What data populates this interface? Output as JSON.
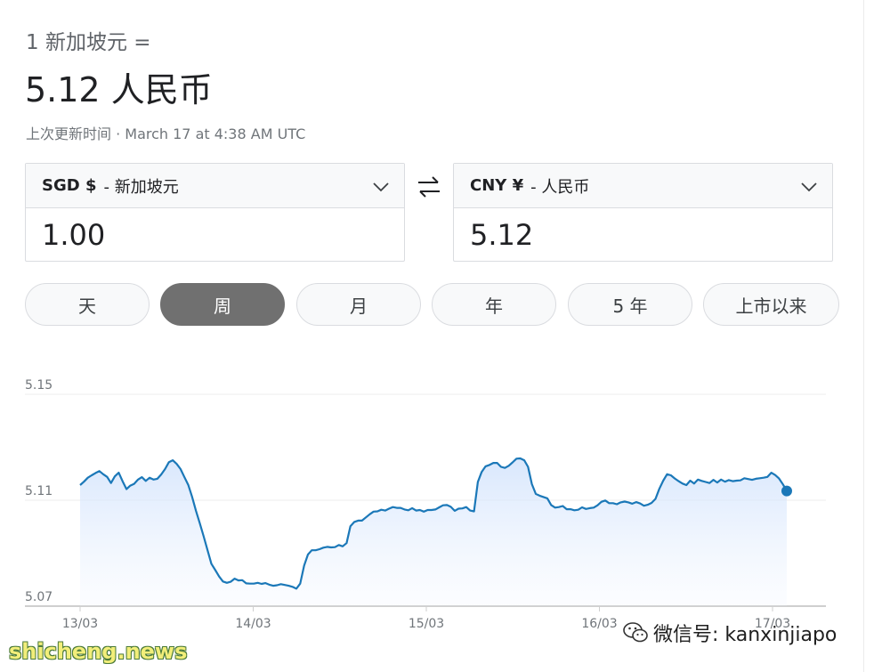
{
  "header": {
    "subtitle": "1 新加坡元 =",
    "rate": "5.12 人民币",
    "updated": "上次更新时间 · March 17 at 4:38 AM UTC"
  },
  "from": {
    "code": "SGD $",
    "name": "- 新加坡元",
    "amount": "1.00"
  },
  "to": {
    "code": "CNY ¥",
    "name": "- 人民币",
    "amount": "5.12"
  },
  "swap_icon": "swap-arrows-icon",
  "ranges": [
    {
      "label": "天",
      "active": false
    },
    {
      "label": "周",
      "active": true
    },
    {
      "label": "月",
      "active": false
    },
    {
      "label": "年",
      "active": false
    },
    {
      "label": "5 年",
      "active": false
    },
    {
      "label": "上市以来",
      "active": false
    }
  ],
  "colors": {
    "line": "#1a73e8",
    "accent": "#1b78b8",
    "active_pill": "#707070"
  },
  "chart_data": {
    "type": "line",
    "yticks": [
      "5.15",
      "5.11",
      "5.07"
    ],
    "ylim": [
      5.07,
      5.15
    ],
    "grid": true,
    "xticks": [
      "13/03",
      "14/03",
      "15/03",
      "16/03",
      "17/03"
    ],
    "series": [
      {
        "values": [
          5.1157,
          5.117,
          5.1185,
          5.1194,
          5.1203,
          5.121,
          5.1198,
          5.1188,
          5.1165,
          5.119,
          5.1204,
          5.1172,
          5.1142,
          5.1155,
          5.1162,
          5.1178,
          5.1187,
          5.1173,
          5.1185,
          5.1178,
          5.1181,
          5.1197,
          5.1218,
          5.1244,
          5.1251,
          5.1237,
          5.1218,
          5.1188,
          5.1158,
          5.1113,
          5.106,
          5.1013,
          5.0964,
          5.0911,
          5.086,
          5.0836,
          5.0812,
          5.0793,
          5.0788,
          5.0792,
          5.0804,
          5.0797,
          5.0798,
          5.0786,
          5.0785,
          5.0785,
          5.0788,
          5.0784,
          5.0787,
          5.0781,
          5.0777,
          5.0779,
          5.0783,
          5.078,
          5.0777,
          5.0773,
          5.0766,
          5.0785,
          5.0853,
          5.0895,
          5.0911,
          5.0911,
          5.0915,
          5.0921,
          5.0924,
          5.0922,
          5.0923,
          5.0931,
          5.0926,
          5.0938,
          5.1002,
          5.1018,
          5.1023,
          5.1023,
          5.1035,
          5.1047,
          5.1057,
          5.1058,
          5.1064,
          5.1061,
          5.1068,
          5.1074,
          5.1071,
          5.1071,
          5.1065,
          5.1062,
          5.107,
          5.1061,
          5.1063,
          5.1057,
          5.1063,
          5.1063,
          5.1065,
          5.1073,
          5.1081,
          5.1082,
          5.1075,
          5.106,
          5.1068,
          5.1069,
          5.1074,
          5.1061,
          5.1058,
          5.1169,
          5.1207,
          5.1228,
          5.1233,
          5.1241,
          5.1241,
          5.1226,
          5.1222,
          5.123,
          5.1243,
          5.1257,
          5.1258,
          5.1251,
          5.1226,
          5.1161,
          5.1124,
          5.1117,
          5.1112,
          5.1107,
          5.1082,
          5.1072,
          5.1074,
          5.1078,
          5.1066,
          5.1066,
          5.1062,
          5.1064,
          5.1073,
          5.1067,
          5.107,
          5.1072,
          5.1081,
          5.1094,
          5.1099,
          5.1089,
          5.1089,
          5.1085,
          5.1092,
          5.1095,
          5.1092,
          5.1087,
          5.1093,
          5.1088,
          5.1079,
          5.1083,
          5.109,
          5.1105,
          5.1143,
          5.1174,
          5.1198,
          5.1194,
          5.1182,
          5.1172,
          5.1163,
          5.1157,
          5.1174,
          5.1163,
          5.1178,
          5.1173,
          5.1169,
          5.1165,
          5.1177,
          5.1167,
          5.1178,
          5.117,
          5.1176,
          5.1172,
          5.1174,
          5.1175,
          5.1183,
          5.118,
          5.1177,
          5.1181,
          5.1183,
          5.1185,
          5.1188,
          5.1204,
          5.1195,
          5.1182,
          5.116,
          5.1135
        ]
      }
    ]
  },
  "watermark_left": "shicheng.news",
  "watermark_right": "微信号: kanxinjiapo"
}
